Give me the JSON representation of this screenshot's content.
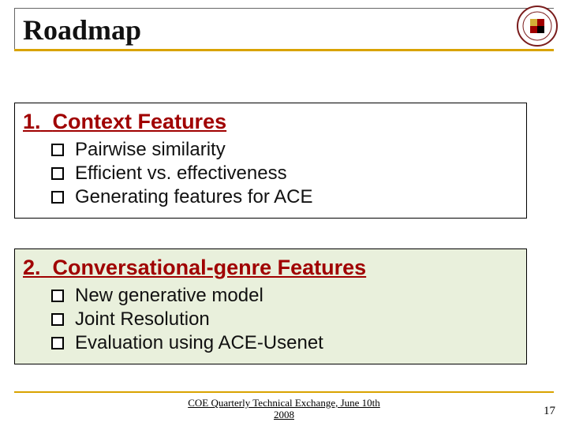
{
  "title": "Roadmap",
  "logo_alt": "University of Maryland seal",
  "sections": [
    {
      "num": "1.",
      "heading": "Context Features",
      "bullets": [
        "Pairwise similarity",
        "Efficient vs. effectiveness",
        "Generating features for ACE"
      ]
    },
    {
      "num": "2.",
      "heading": "Conversational-genre Features",
      "bullets": [
        "New generative model",
        "Joint Resolution",
        "Evaluation using ACE-Usenet"
      ]
    }
  ],
  "footer": {
    "line1": "COE Quarterly Technical Exchange, June 10th",
    "line2": "2008"
  },
  "page_number": "17"
}
